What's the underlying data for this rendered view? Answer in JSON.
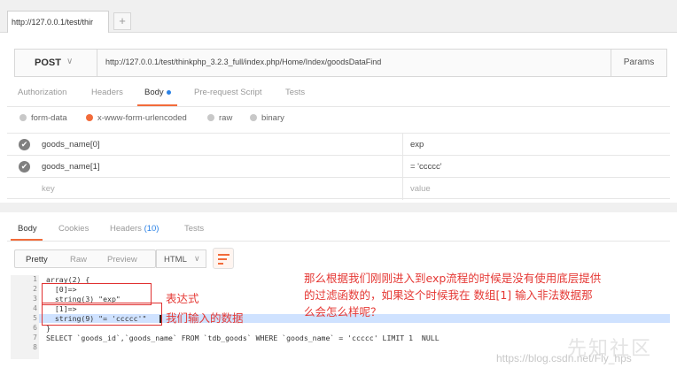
{
  "tab": {
    "title": "http://127.0.0.1/test/thir",
    "plus": "+"
  },
  "request": {
    "method": "POST",
    "method_chevron": "∨",
    "url": "http://127.0.0.1/test/thinkphp_3.2.3_full/index.php/Home/Index/goodsDataFind",
    "params_label": "Params"
  },
  "subtabs": [
    "Authorization",
    "Headers",
    "Body",
    "Pre-request Script",
    "Tests"
  ],
  "body_types": [
    "form-data",
    "x-www-form-urlencoded",
    "raw",
    "binary"
  ],
  "kv_rows": [
    {
      "key": "goods_name[0]",
      "value": "exp"
    },
    {
      "key": "goods_name[1]",
      "value": "= 'ccccc'"
    },
    {
      "key": "key",
      "value": "value"
    }
  ],
  "response_tabs": {
    "body": "Body",
    "cookies": "Cookies",
    "headers": "Headers",
    "headers_count": "(10)",
    "tests": "Tests"
  },
  "view_buttons": [
    "Pretty",
    "Raw",
    "Preview"
  ],
  "format": {
    "label": "HTML",
    "chevron": "∨"
  },
  "code": {
    "line_numbers": [
      "1",
      "2",
      "3",
      "4",
      "5",
      "6",
      "7",
      "8"
    ],
    "lines": [
      "array(2) {",
      "  [0]=>",
      "  string(3) \"exp\"",
      "  [1]=>",
      "  string(9) \"= 'ccccc'\"",
      "}",
      "SELECT `goods_id`,`goods_name` FROM `tdb_goods` WHERE `goods_name` = 'ccccc' LIMIT 1  NULL",
      ""
    ],
    "fold_marker": "1"
  },
  "annotations": {
    "expression": "表达式",
    "input_data": "我们输入的数据",
    "question_1": "那么根据我们刚刚进入到exp流程的时候是没有使用底层提供",
    "question_2": "的过滤函数的，如果这个时候我在 数组[1] 输入非法数据那",
    "question_3": "么会怎么样呢？"
  },
  "watermark": {
    "url": "https://blog.csdn.net/Fly_hps",
    "brand": "先知社区"
  },
  "colors": {
    "accent": "#f26b3a",
    "annotation": "#e53935",
    "link": "#2b82e6"
  }
}
